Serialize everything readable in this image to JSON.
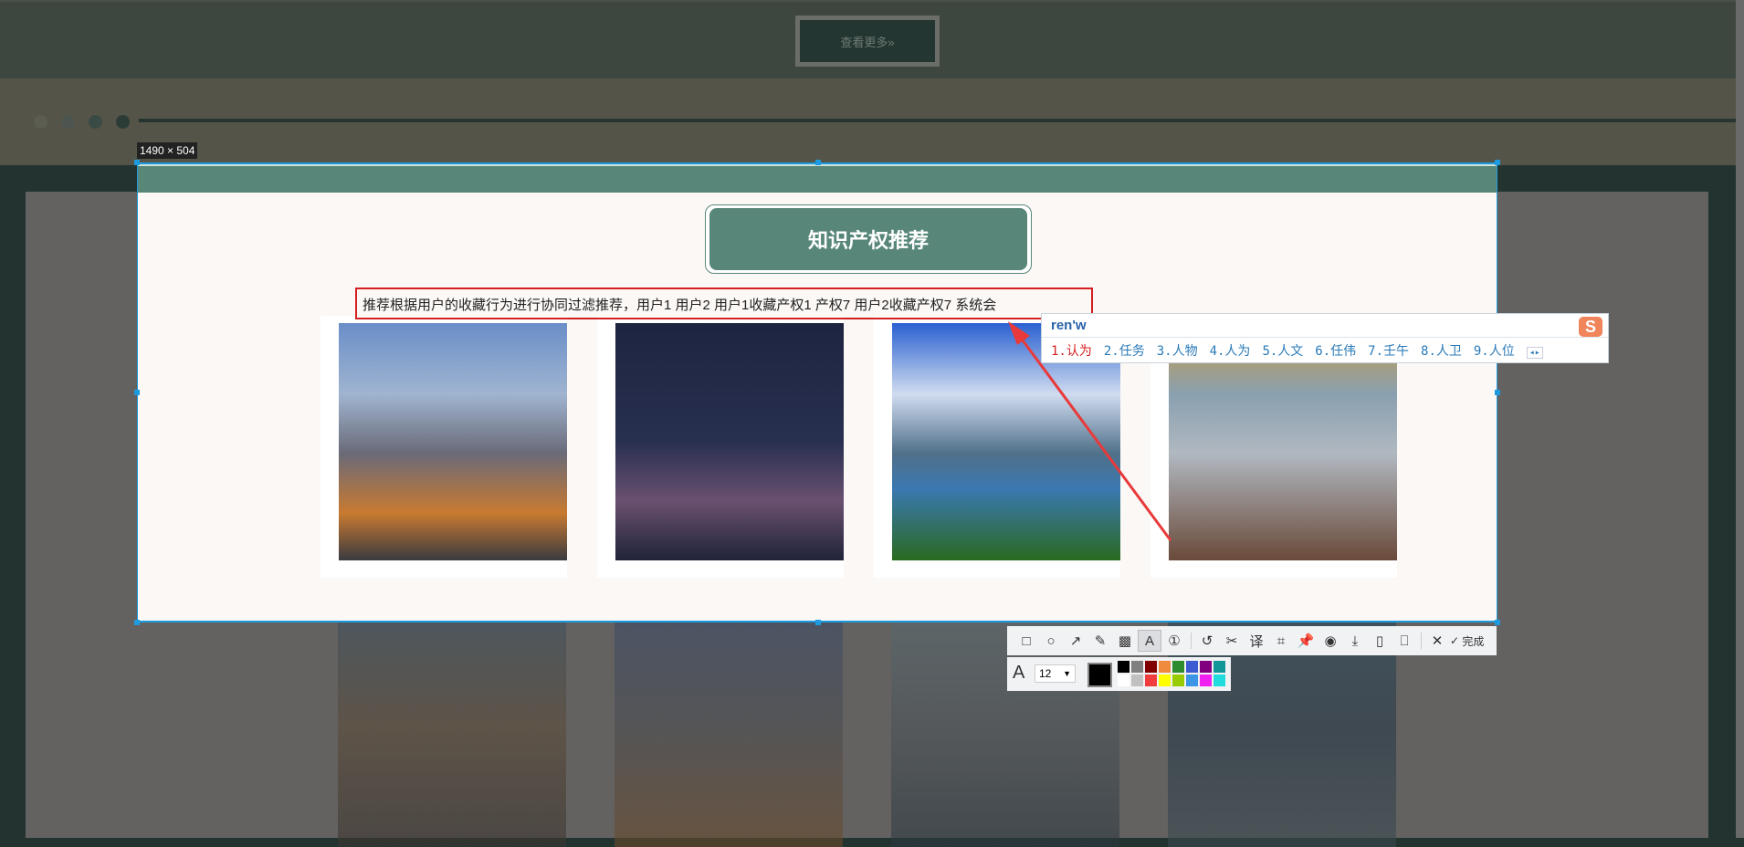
{
  "page": {
    "more_button": "查看更多»",
    "section_title": "知识产权推荐"
  },
  "screenshot_tool": {
    "dimension_label": "1490 × 504",
    "text_annotation": "推荐根据用户的收藏行为进行协同过滤推荐，用户1 用户2 用户1收藏产权1 产权7 用户2收藏产权7 系统会",
    "toolbar": {
      "items": [
        "rectangle",
        "ellipse",
        "arrow",
        "pencil",
        "mosaic",
        "text",
        "number",
        "undo",
        "cut",
        "translate",
        "ocr",
        "pin",
        "record",
        "save",
        "phone",
        "bookmark",
        "close"
      ],
      "done_label": "完成"
    },
    "font_size": "12",
    "current_color": "#000000",
    "palette": [
      "#000000",
      "#808080",
      "#800000",
      "#f08a3c",
      "#2e8b2e",
      "#3c5ad2",
      "#800080",
      "#109898",
      "#ffffff",
      "#c0c0c0",
      "#f03c3c",
      "#ffff00",
      "#99cc00",
      "#3c96e6",
      "#f020f0",
      "#20dcdc"
    ]
  },
  "ime": {
    "input": "ren'w",
    "candidates": [
      "1.认为",
      "2.任务",
      "3.人物",
      "4.人为",
      "5.人文",
      "6.任伟",
      "7.壬午",
      "8.人卫",
      "9.人位"
    ],
    "logo": "S"
  },
  "colors": {
    "accent": "#58877a",
    "selection": "#1e9be0",
    "annotation": "#d42020"
  }
}
